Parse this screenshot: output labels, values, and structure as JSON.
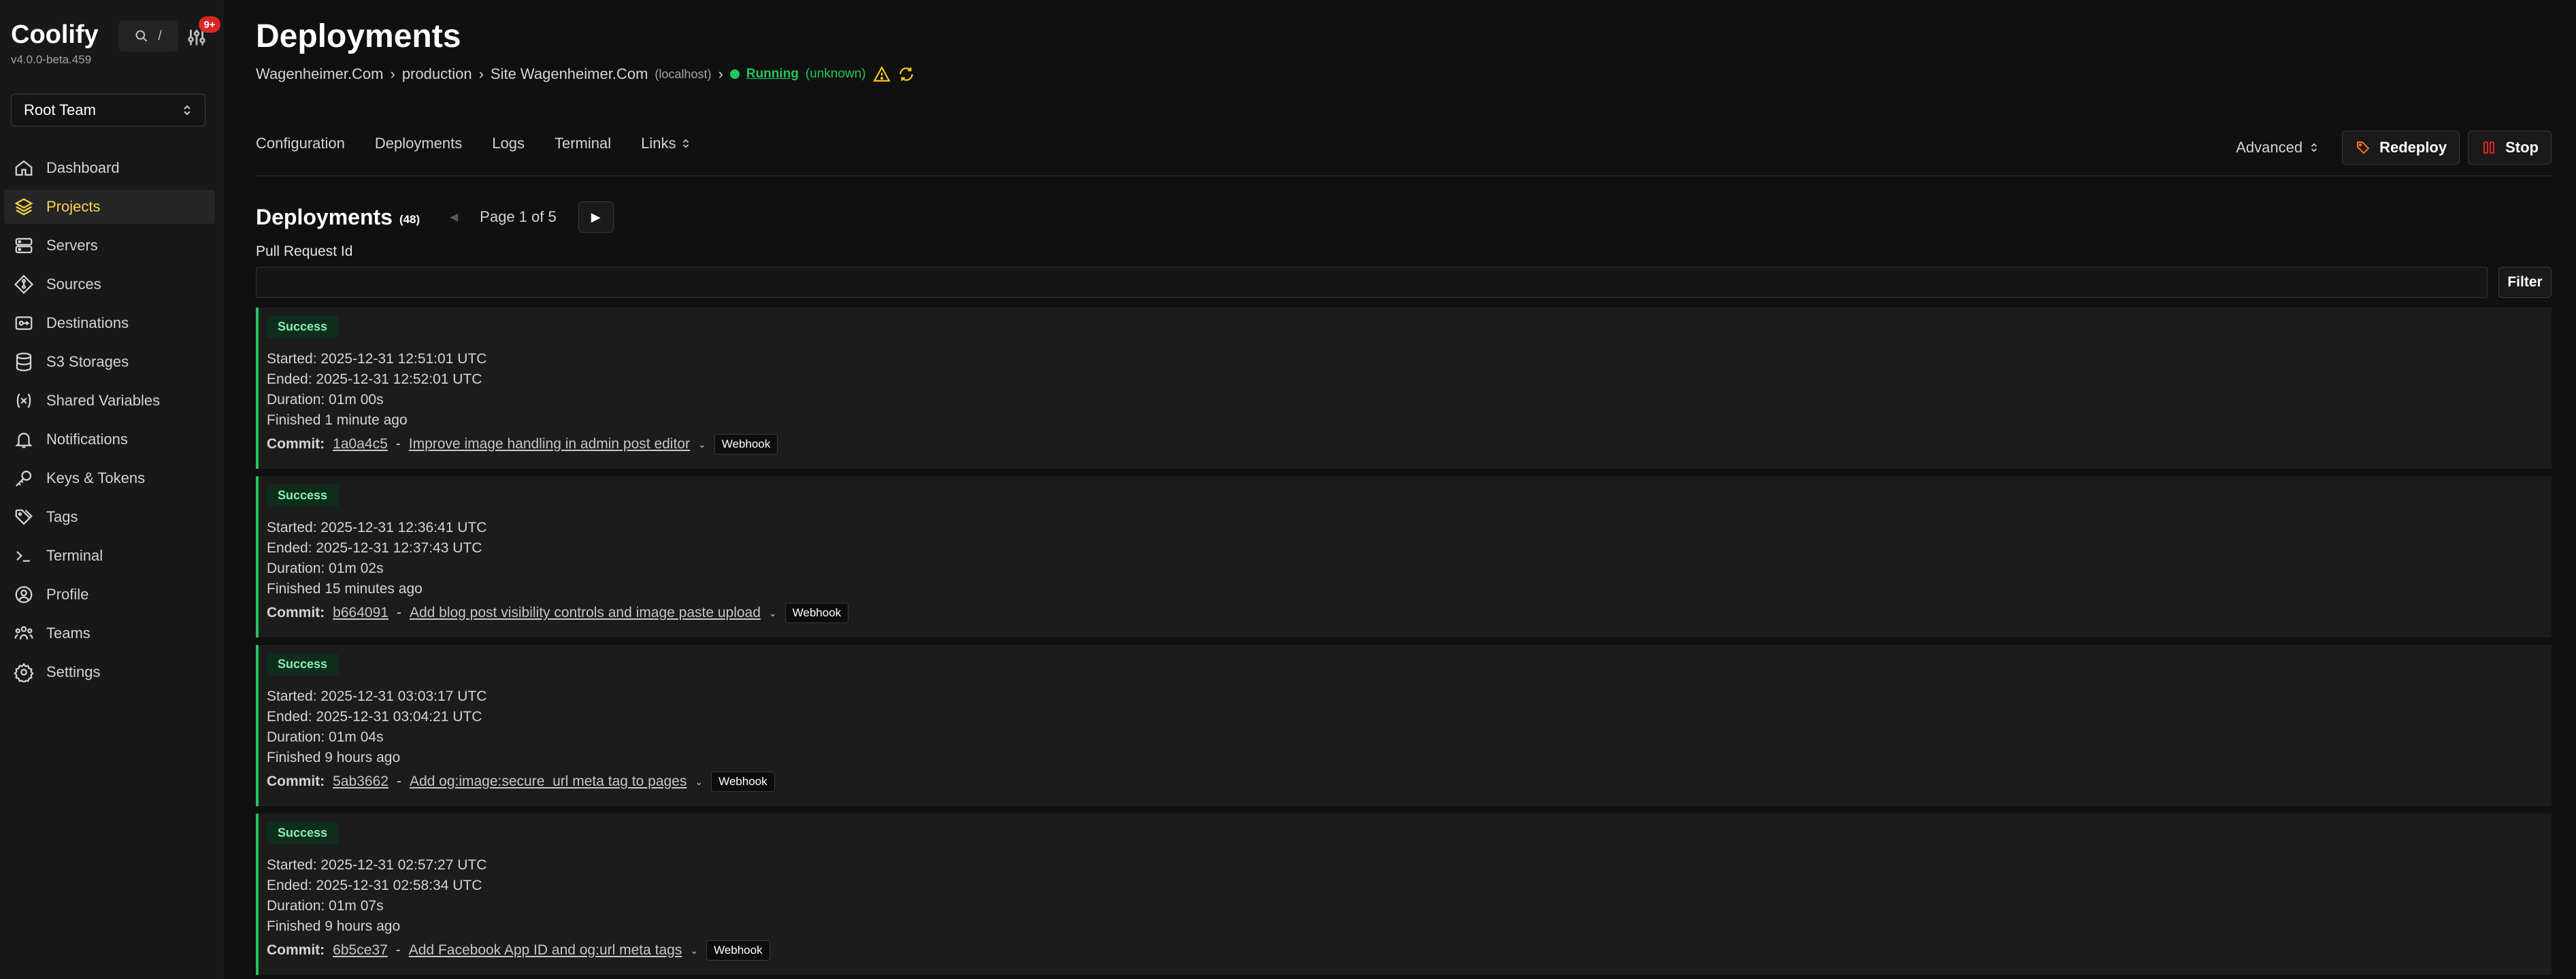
{
  "app": {
    "name": "Coolify",
    "version": "v4.0.0-beta.459",
    "search_key": "/",
    "notifications_badge": "9+",
    "team": "Root Team"
  },
  "sidebar": {
    "items": [
      {
        "label": "Dashboard",
        "icon": "home-icon"
      },
      {
        "label": "Projects",
        "icon": "layers-icon",
        "active": true
      },
      {
        "label": "Servers",
        "icon": "server-icon"
      },
      {
        "label": "Sources",
        "icon": "git-icon"
      },
      {
        "label": "Destinations",
        "icon": "destination-icon"
      },
      {
        "label": "S3 Storages",
        "icon": "database-icon"
      },
      {
        "label": "Shared Variables",
        "icon": "variable-icon"
      },
      {
        "label": "Notifications",
        "icon": "bell-icon"
      },
      {
        "label": "Keys & Tokens",
        "icon": "key-icon"
      },
      {
        "label": "Tags",
        "icon": "tag-icon"
      },
      {
        "label": "Terminal",
        "icon": "terminal-icon"
      },
      {
        "label": "Profile",
        "icon": "user-icon"
      },
      {
        "label": "Teams",
        "icon": "team-icon"
      },
      {
        "label": "Settings",
        "icon": "gear-icon"
      }
    ]
  },
  "page": {
    "title": "Deployments",
    "breadcrumb": {
      "project": "Wagenheimer.Com",
      "environment": "production",
      "resource": "Site Wagenheimer.Com",
      "server": "(localhost)",
      "status": "Running",
      "status_sub": "(unknown)"
    },
    "tabs": [
      "Configuration",
      "Deployments",
      "Logs",
      "Terminal",
      "Links"
    ],
    "advanced_label": "Advanced",
    "redeploy_label": "Redeploy",
    "stop_label": "Stop",
    "colors": {
      "accent": "#fcd452",
      "success": "#22c55e",
      "danger": "#dc2626",
      "redeploy_icon": "#f97316"
    }
  },
  "deployments": {
    "title": "Deployments",
    "count": "(48)",
    "page_text": "Page 1 of 5",
    "filter_label": "Pull Request Id",
    "filter_value": "",
    "filter_button": "Filter",
    "commit_label": "Commit:",
    "items": [
      {
        "status": "Success",
        "started": "Started: 2025-12-31 12:51:01 UTC",
        "ended": "Ended: 2025-12-31 12:52:01 UTC",
        "duration": "Duration: 01m 00s",
        "finished": "Finished 1 minute ago",
        "hash": "1a0a4c5",
        "message": "Improve image handling in admin post editor",
        "trigger": "Webhook"
      },
      {
        "status": "Success",
        "started": "Started: 2025-12-31 12:36:41 UTC",
        "ended": "Ended: 2025-12-31 12:37:43 UTC",
        "duration": "Duration: 01m 02s",
        "finished": "Finished 15 minutes ago",
        "hash": "b664091",
        "message": "Add blog post visibility controls and image paste upload",
        "trigger": "Webhook"
      },
      {
        "status": "Success",
        "started": "Started: 2025-12-31 03:03:17 UTC",
        "ended": "Ended: 2025-12-31 03:04:21 UTC",
        "duration": "Duration: 01m 04s",
        "finished": "Finished 9 hours ago",
        "hash": "5ab3662",
        "message": "Add og:image:secure_url meta tag to pages",
        "trigger": "Webhook"
      },
      {
        "status": "Success",
        "started": "Started: 2025-12-31 02:57:27 UTC",
        "ended": "Ended: 2025-12-31 02:58:34 UTC",
        "duration": "Duration: 01m 07s",
        "finished": "Finished 9 hours ago",
        "hash": "6b5ce37",
        "message": "Add Facebook App ID and og:url meta tags",
        "trigger": "Webhook"
      }
    ]
  }
}
